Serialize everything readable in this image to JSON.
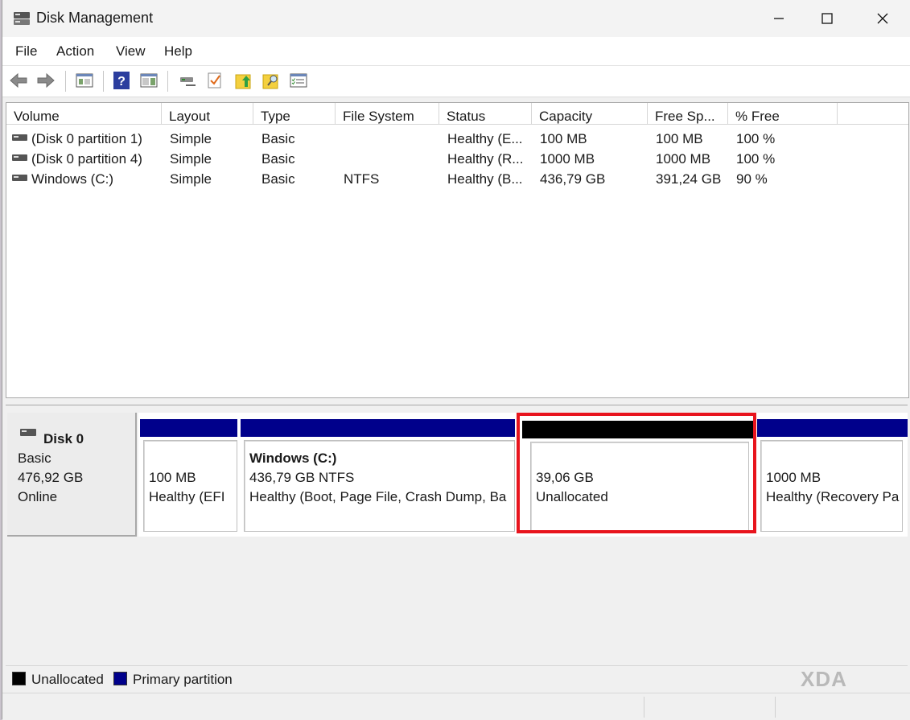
{
  "window": {
    "title": "Disk Management"
  },
  "menu": [
    "File",
    "Action",
    "View",
    "Help"
  ],
  "toolbar": [
    "back-icon",
    "forward-icon",
    "console-tree-icon",
    "help-icon",
    "action-pane-icon",
    "connect-drive-icon",
    "check-icon",
    "folder-up-icon",
    "folder-search-icon",
    "properties-icon"
  ],
  "volumes": {
    "columns": [
      "Volume",
      "Layout",
      "Type",
      "File System",
      "Status",
      "Capacity",
      "Free Sp...",
      "% Free"
    ],
    "rows": [
      [
        "(Disk 0 partition 1)",
        "Simple",
        "Basic",
        "",
        "Healthy (E...",
        "100 MB",
        "100 MB",
        "100 %"
      ],
      [
        "(Disk 0 partition 4)",
        "Simple",
        "Basic",
        "",
        "Healthy (R...",
        "1000 MB",
        "1000 MB",
        "100 %"
      ],
      [
        "Windows (C:)",
        "Simple",
        "Basic",
        "NTFS",
        "Healthy (B...",
        "436,79 GB",
        "391,24 GB",
        "90 %"
      ]
    ]
  },
  "disk": {
    "name": "Disk 0",
    "type": "Basic",
    "size": "476,92 GB",
    "state": "Online",
    "partitions": [
      {
        "title": "",
        "size": "100 MB",
        "status": "Healthy (EFI",
        "kind": "primary"
      },
      {
        "title": "Windows  (C:)",
        "size": "436,79 GB NTFS",
        "status": "Healthy (Boot, Page File, Crash Dump, Ba",
        "kind": "primary"
      },
      {
        "title": "",
        "size": "39,06 GB",
        "status": "Unallocated",
        "kind": "unallocated"
      },
      {
        "title": "",
        "size": "1000 MB",
        "status": "Healthy (Recovery Pa",
        "kind": "primary"
      }
    ]
  },
  "legend": [
    {
      "label": "Unallocated",
      "color": "#000000"
    },
    {
      "label": "Primary partition",
      "color": "#00008b"
    }
  ],
  "colors": {
    "primary": "#00008b",
    "unallocated": "#000000",
    "highlight": "#e8141d"
  },
  "watermark": "XDA"
}
